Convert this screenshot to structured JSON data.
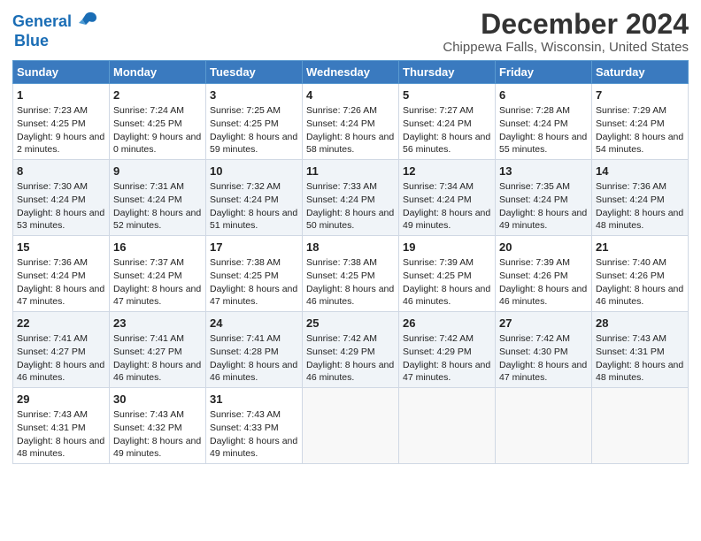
{
  "header": {
    "logo_line1": "General",
    "logo_line2": "Blue",
    "title": "December 2024",
    "subtitle": "Chippewa Falls, Wisconsin, United States"
  },
  "days_of_week": [
    "Sunday",
    "Monday",
    "Tuesday",
    "Wednesday",
    "Thursday",
    "Friday",
    "Saturday"
  ],
  "weeks": [
    [
      {
        "day": 1,
        "sunrise": "7:23 AM",
        "sunset": "4:25 PM",
        "daylight": "9 hours and 2 minutes."
      },
      {
        "day": 2,
        "sunrise": "7:24 AM",
        "sunset": "4:25 PM",
        "daylight": "9 hours and 0 minutes."
      },
      {
        "day": 3,
        "sunrise": "7:25 AM",
        "sunset": "4:25 PM",
        "daylight": "8 hours and 59 minutes."
      },
      {
        "day": 4,
        "sunrise": "7:26 AM",
        "sunset": "4:24 PM",
        "daylight": "8 hours and 58 minutes."
      },
      {
        "day": 5,
        "sunrise": "7:27 AM",
        "sunset": "4:24 PM",
        "daylight": "8 hours and 56 minutes."
      },
      {
        "day": 6,
        "sunrise": "7:28 AM",
        "sunset": "4:24 PM",
        "daylight": "8 hours and 55 minutes."
      },
      {
        "day": 7,
        "sunrise": "7:29 AM",
        "sunset": "4:24 PM",
        "daylight": "8 hours and 54 minutes."
      }
    ],
    [
      {
        "day": 8,
        "sunrise": "7:30 AM",
        "sunset": "4:24 PM",
        "daylight": "8 hours and 53 minutes."
      },
      {
        "day": 9,
        "sunrise": "7:31 AM",
        "sunset": "4:24 PM",
        "daylight": "8 hours and 52 minutes."
      },
      {
        "day": 10,
        "sunrise": "7:32 AM",
        "sunset": "4:24 PM",
        "daylight": "8 hours and 51 minutes."
      },
      {
        "day": 11,
        "sunrise": "7:33 AM",
        "sunset": "4:24 PM",
        "daylight": "8 hours and 50 minutes."
      },
      {
        "day": 12,
        "sunrise": "7:34 AM",
        "sunset": "4:24 PM",
        "daylight": "8 hours and 49 minutes."
      },
      {
        "day": 13,
        "sunrise": "7:35 AM",
        "sunset": "4:24 PM",
        "daylight": "8 hours and 49 minutes."
      },
      {
        "day": 14,
        "sunrise": "7:36 AM",
        "sunset": "4:24 PM",
        "daylight": "8 hours and 48 minutes."
      }
    ],
    [
      {
        "day": 15,
        "sunrise": "7:36 AM",
        "sunset": "4:24 PM",
        "daylight": "8 hours and 47 minutes."
      },
      {
        "day": 16,
        "sunrise": "7:37 AM",
        "sunset": "4:24 PM",
        "daylight": "8 hours and 47 minutes."
      },
      {
        "day": 17,
        "sunrise": "7:38 AM",
        "sunset": "4:25 PM",
        "daylight": "8 hours and 47 minutes."
      },
      {
        "day": 18,
        "sunrise": "7:38 AM",
        "sunset": "4:25 PM",
        "daylight": "8 hours and 46 minutes."
      },
      {
        "day": 19,
        "sunrise": "7:39 AM",
        "sunset": "4:25 PM",
        "daylight": "8 hours and 46 minutes."
      },
      {
        "day": 20,
        "sunrise": "7:39 AM",
        "sunset": "4:26 PM",
        "daylight": "8 hours and 46 minutes."
      },
      {
        "day": 21,
        "sunrise": "7:40 AM",
        "sunset": "4:26 PM",
        "daylight": "8 hours and 46 minutes."
      }
    ],
    [
      {
        "day": 22,
        "sunrise": "7:41 AM",
        "sunset": "4:27 PM",
        "daylight": "8 hours and 46 minutes."
      },
      {
        "day": 23,
        "sunrise": "7:41 AM",
        "sunset": "4:27 PM",
        "daylight": "8 hours and 46 minutes."
      },
      {
        "day": 24,
        "sunrise": "7:41 AM",
        "sunset": "4:28 PM",
        "daylight": "8 hours and 46 minutes."
      },
      {
        "day": 25,
        "sunrise": "7:42 AM",
        "sunset": "4:29 PM",
        "daylight": "8 hours and 46 minutes."
      },
      {
        "day": 26,
        "sunrise": "7:42 AM",
        "sunset": "4:29 PM",
        "daylight": "8 hours and 47 minutes."
      },
      {
        "day": 27,
        "sunrise": "7:42 AM",
        "sunset": "4:30 PM",
        "daylight": "8 hours and 47 minutes."
      },
      {
        "day": 28,
        "sunrise": "7:43 AM",
        "sunset": "4:31 PM",
        "daylight": "8 hours and 48 minutes."
      }
    ],
    [
      {
        "day": 29,
        "sunrise": "7:43 AM",
        "sunset": "4:31 PM",
        "daylight": "8 hours and 48 minutes."
      },
      {
        "day": 30,
        "sunrise": "7:43 AM",
        "sunset": "4:32 PM",
        "daylight": "8 hours and 49 minutes."
      },
      {
        "day": 31,
        "sunrise": "7:43 AM",
        "sunset": "4:33 PM",
        "daylight": "8 hours and 49 minutes."
      },
      null,
      null,
      null,
      null
    ]
  ]
}
